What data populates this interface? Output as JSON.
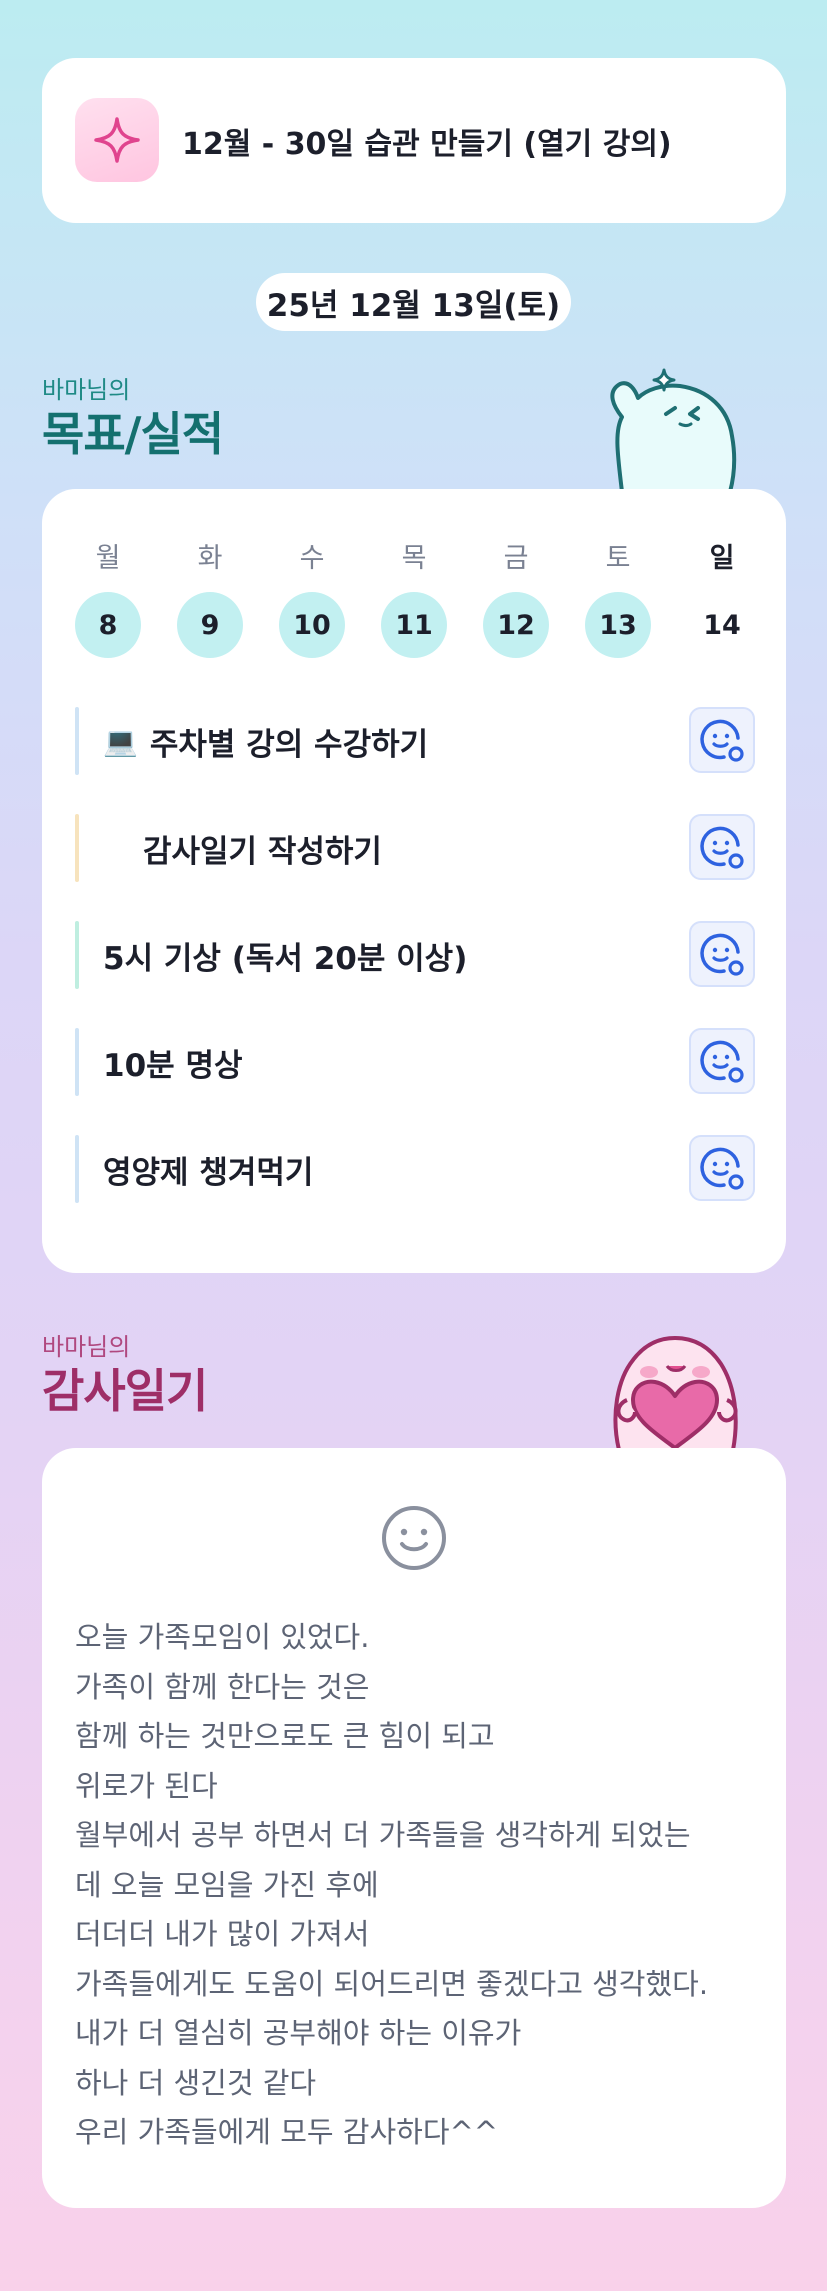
{
  "header": {
    "icon": "sparkle-icon",
    "title": "12월 - 30일 습관 만들기 (열기 강의)"
  },
  "date": "25년 12월 13일(토)",
  "goals": {
    "owner": "바마님의",
    "title": "목표/실적",
    "week": [
      {
        "day": "월",
        "num": "8",
        "done": true
      },
      {
        "day": "화",
        "num": "9",
        "done": true
      },
      {
        "day": "수",
        "num": "10",
        "done": true
      },
      {
        "day": "목",
        "num": "11",
        "done": true
      },
      {
        "day": "금",
        "num": "12",
        "done": true
      },
      {
        "day": "토",
        "num": "13",
        "done": true
      },
      {
        "day": "일",
        "num": "14",
        "done": false
      }
    ],
    "habits": [
      {
        "icon": "laptop-icon",
        "label": "주차별 강의 수강하기",
        "color": "#cfe3f5"
      },
      {
        "icon": "",
        "label": "감사일기 작성하기",
        "color": "#f7e3bd"
      },
      {
        "icon": "",
        "label": "5시 기상 (독서 20분 이상)",
        "color": "#bfeee0"
      },
      {
        "icon": "",
        "label": "10분 명상",
        "color": "#cfe3f5"
      },
      {
        "icon": "",
        "label": "영양제 챙겨먹기",
        "color": "#cfe3f5"
      }
    ]
  },
  "diary": {
    "owner": "바마님의",
    "title": "감사일기",
    "mood_icon": "smile-face-icon",
    "lines": [
      "오늘 가족모임이 있었다.",
      "가족이 함께 한다는 것은",
      "함께 하는 것만으로도 큰 힘이 되고",
      "위로가 된다",
      "월부에서 공부 하면서 더 가족들을 생각하게 되었는",
      "데 오늘 모임을 가진 후에",
      "더더더 내가 많이 가져서",
      "가족들에게도 도움이 되어드리면 좋겠다고 생각했다.",
      "내가 더 열심히 공부해야 하는 이유가",
      "하나 더 생긴것 같다",
      "우리 가족들에게 모두 감사하다^^"
    ]
  },
  "colors": {
    "teal_title": "#14706f",
    "pink_title": "#9e2e67",
    "day_fill": "#c2f0f1",
    "emoji_btn": "#2e62e0"
  }
}
